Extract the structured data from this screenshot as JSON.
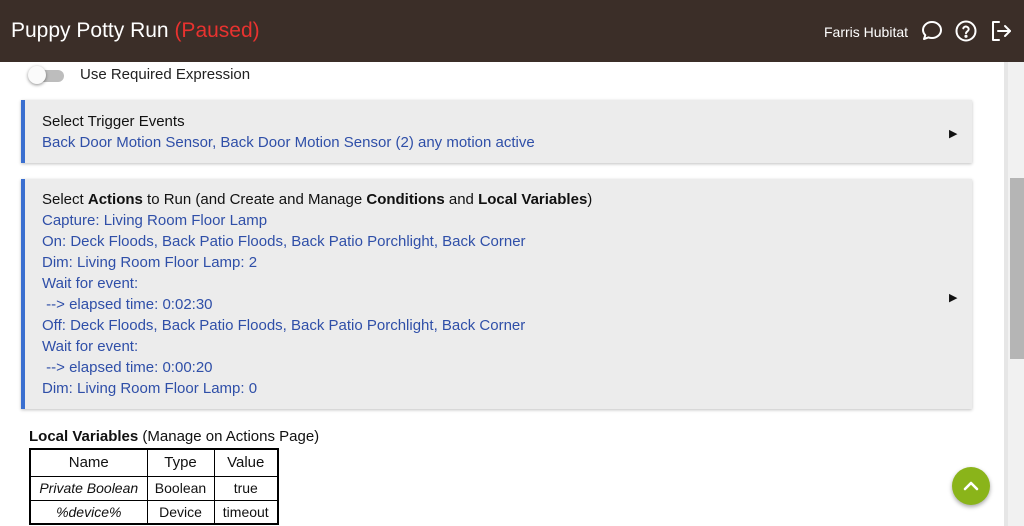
{
  "header": {
    "title": "Puppy Potty Run",
    "status": "(Paused)",
    "user": "Farris Hubitat",
    "icons": [
      "chat-icon",
      "help-icon",
      "logout-icon"
    ]
  },
  "settings": {
    "toggle_label": "Use Required Expression",
    "toggle_on": false
  },
  "trigger_card": {
    "title": "Select Trigger Events",
    "summary": "Back Door Motion Sensor, Back Door Motion Sensor (2) any motion active"
  },
  "actions_card": {
    "title_prefix": "Select ",
    "title_actions": "Actions",
    "title_mid1": " to Run (and Create and Manage ",
    "title_conditions": "Conditions",
    "title_mid2": " and ",
    "title_locals": "Local Variables",
    "title_suffix": ")",
    "lines": [
      "Capture: Living Room Floor Lamp",
      "On: Deck Floods, Back Patio Floods, Back Patio Porchlight, Back Corner",
      "Dim: Living Room Floor Lamp: 2",
      "Wait for event:",
      " --> elapsed time: 0:02:30",
      "Off: Deck Floods, Back Patio Floods, Back Patio Porchlight, Back Corner",
      "Wait for event:",
      " --> elapsed time: 0:00:20",
      "Dim: Living Room Floor Lamp: 0"
    ]
  },
  "local_variables": {
    "heading": "Local Variables",
    "note": " (Manage on Actions Page)",
    "columns": [
      "Name",
      "Type",
      "Value"
    ],
    "rows": [
      {
        "name": "Private Boolean",
        "type": "Boolean",
        "value": "true"
      },
      {
        "name": "%device%",
        "type": "Device",
        "value": "timeout"
      }
    ]
  },
  "colors": {
    "header_bg": "#3b2e28",
    "status_red": "#e8322f",
    "link_blue": "#2f4fa8",
    "accent_blue": "#3a6fd0",
    "fab_green": "#8ab41a"
  },
  "fab": {
    "icon": "chevron-up-icon"
  }
}
